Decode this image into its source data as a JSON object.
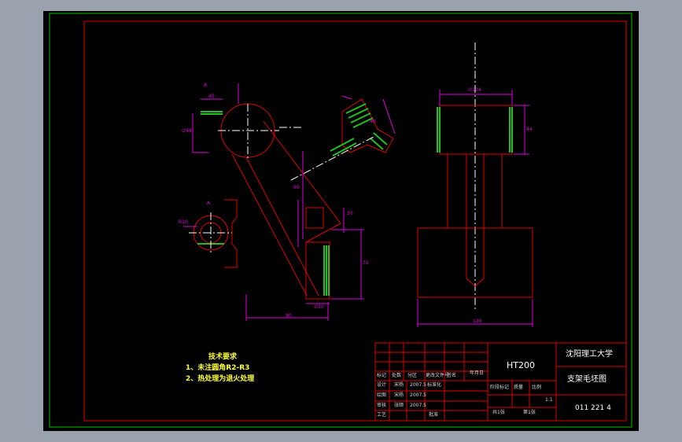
{
  "colors": {
    "background": "#9aa3ad",
    "canvas": "#000000",
    "outer_frame": "#00c000",
    "inner_frame": "#e00000",
    "part_outline": "#e00000",
    "dimension": "#e000e0",
    "centerline": "#ffffff",
    "hatch": "#20c020",
    "title_block_text": "#ffffff",
    "notes_text": "#ffff33"
  },
  "title_block": {
    "material": "HT200",
    "school": "沈阳理工大学",
    "drawing_name": "支架毛坯图",
    "drawing_number": "011 221 4",
    "scale": "1:1",
    "sheet_total": "共1张",
    "sheet_number": "第1张",
    "headers": {
      "mark": "标记",
      "count": "处数",
      "zone": "分区",
      "change_doc": "更改文件号",
      "signature": "签名",
      "date": "年月日",
      "stage_mark": "阶段标记",
      "weight": "质量",
      "scale_label": "比例"
    },
    "rows": [
      {
        "role": "设计",
        "name": "宋杨",
        "date": "2007.5",
        "label2": "标准化"
      },
      {
        "role": "绘图",
        "name": "宋杨",
        "date": "2007.5",
        "label2": ""
      },
      {
        "role": "审核",
        "name": "张顺",
        "date": "2007.5",
        "label2": ""
      },
      {
        "role": "工艺",
        "name": "",
        "date": "",
        "label2": "批准"
      }
    ]
  },
  "notes": {
    "title": "技术要求",
    "items": [
      "1、未注圆角R2-R3",
      "2、热处理为退火处理"
    ]
  },
  "views": {
    "section_label_main": "A",
    "section_label_detail": "A",
    "dim_labels": [
      "40",
      "∅48",
      "∅50",
      "30",
      "80",
      "90",
      "75",
      "40",
      "R10",
      "∅134",
      "44",
      "120"
    ]
  }
}
